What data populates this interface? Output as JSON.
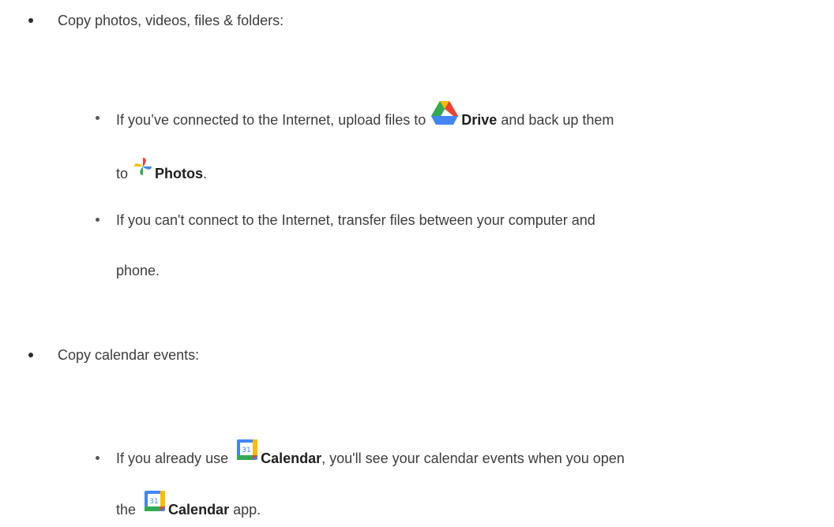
{
  "items": [
    {
      "label": "Copy photos, videos, files & folders:",
      "subitems": [
        {
          "line1_pre": "If you’ve connected to the Internet, upload files to",
          "drive_label": "Drive",
          "line1_post": "and back up them",
          "line2_pre": "to",
          "photos_label": "Photos",
          "line2_post": "."
        },
        {
          "line1": "If you can't connect to the Internet, transfer files between your computer and",
          "line2": "phone."
        }
      ]
    },
    {
      "label": "Copy calendar events:",
      "subitems": [
        {
          "line1_pre": "If you already use",
          "calendar_label": "Calendar",
          "line1_post": ", you'll see your calendar events when you open",
          "line2_pre": "the",
          "calendar_label_2": "Calendar",
          "line2_post": "app.",
          "calendar_icon_text": "31"
        }
      ]
    }
  ],
  "icons": {
    "drive": "drive-icon",
    "photos": "photos-icon",
    "calendar": "calendar-icon"
  },
  "colors": {
    "text": "#3c3c3c",
    "google_blue": "#4285F4",
    "google_red": "#EA4335",
    "google_yellow": "#FBBC04",
    "google_green": "#34A853"
  }
}
